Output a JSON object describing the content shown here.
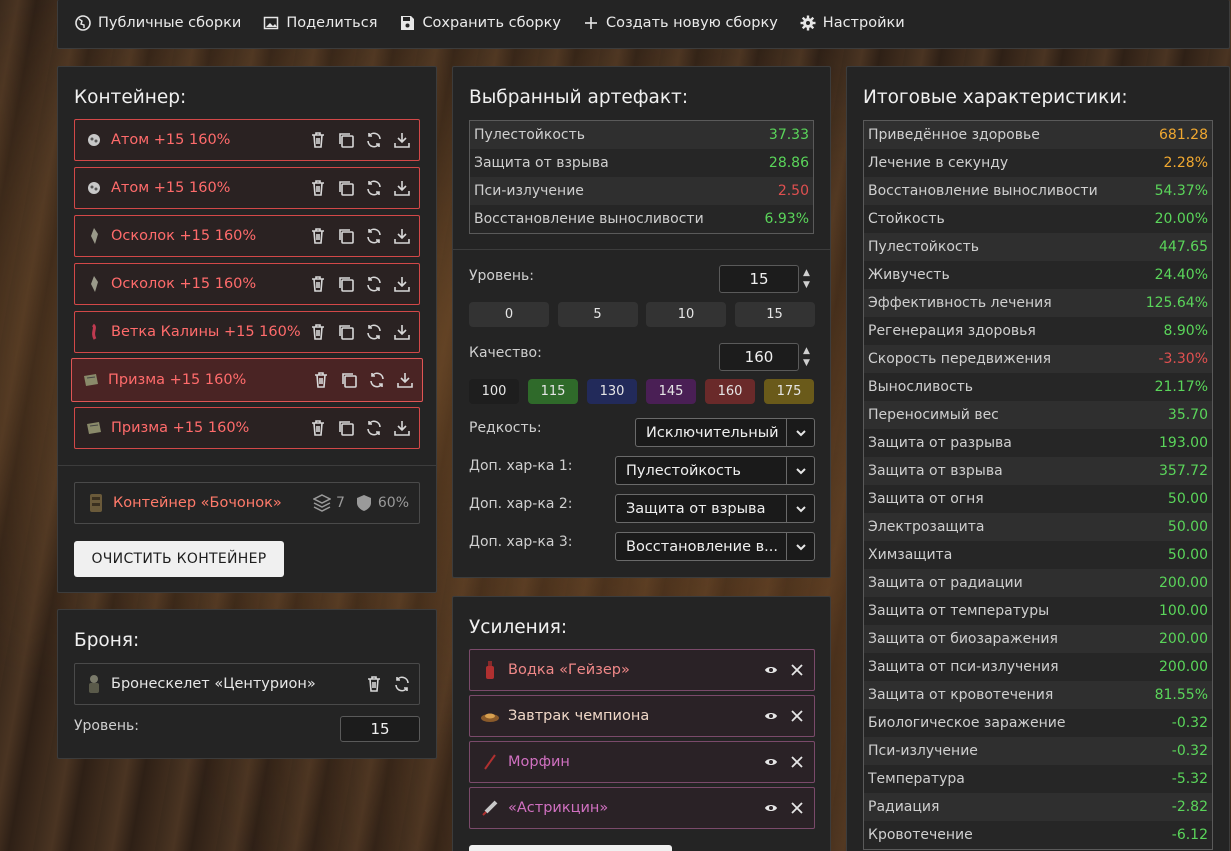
{
  "topbar": {
    "items": [
      {
        "label": "Публичные сборки",
        "icon": "globe-icon"
      },
      {
        "label": "Поделиться",
        "icon": "image-icon"
      },
      {
        "label": "Сохранить сборку",
        "icon": "save-icon"
      },
      {
        "label": "Создать новую сборку",
        "icon": "plus-icon"
      },
      {
        "label": "Настройки",
        "icon": "gear-icon"
      }
    ]
  },
  "container": {
    "title": "Контейнер:",
    "artifacts": [
      {
        "label": "Атом +15 160%",
        "icon": "atom-artifact-icon"
      },
      {
        "label": "Атом +15 160%",
        "icon": "atom-artifact-icon"
      },
      {
        "label": "Осколок +15 160%",
        "icon": "shard-artifact-icon"
      },
      {
        "label": "Осколок +15 160%",
        "icon": "shard-artifact-icon"
      },
      {
        "label": "Ветка Калины +15 160%",
        "icon": "viburnum-artifact-icon"
      },
      {
        "label": "Призма +15 160%",
        "icon": "prism-artifact-icon"
      },
      {
        "label": "Призма +15 160%",
        "icon": "prism-artifact-icon"
      }
    ],
    "selected_index": 5,
    "container_name": "Контейнер «Бочонок»",
    "slots": "7",
    "protection": "60%",
    "clear_button": "ОЧИСТИТЬ КОНТЕЙНЕР"
  },
  "armor": {
    "title": "Броня:",
    "name": "Бронескелет «Центурион»",
    "level_label": "Уровень:",
    "level_value": "15"
  },
  "selected": {
    "title": "Выбранный артефакт:",
    "stats": [
      {
        "label": "Пулестойкость",
        "value": "37.33",
        "color": "green"
      },
      {
        "label": "Защита от взрыва",
        "value": "28.86",
        "color": "green"
      },
      {
        "label": "Пси-излучение",
        "value": "2.50",
        "color": "red"
      },
      {
        "label": "Восстановление выносливости",
        "value": "6.93%",
        "color": "green"
      }
    ],
    "level_label": "Уровень:",
    "level_value": "15",
    "level_presets": [
      "0",
      "5",
      "10",
      "15"
    ],
    "quality_label": "Качество:",
    "quality_value": "160",
    "quality_presets": [
      {
        "label": "100",
        "color": "#1e1e1e"
      },
      {
        "label": "115",
        "color": "#2f6a2a"
      },
      {
        "label": "130",
        "color": "#222a5a"
      },
      {
        "label": "145",
        "color": "#4a1f55"
      },
      {
        "label": "160",
        "color": "#6a2a2a"
      },
      {
        "label": "175",
        "color": "#6a5a1a"
      }
    ],
    "rarity_label": "Редкость:",
    "rarity_value": "Исключительный",
    "extra1_label": "Доп. хар-ка 1:",
    "extra1_value": "Пулестойкость",
    "extra2_label": "Доп. хар-ка 2:",
    "extra2_value": "Защита от взрыва",
    "extra3_label": "Доп. хар-ка 3:",
    "extra3_value": "Восстановление в..."
  },
  "boosts": {
    "title": "Усиления:",
    "items": [
      {
        "label": "Водка «Гейзер»",
        "color": "#f08888",
        "icon": "bottle-icon"
      },
      {
        "label": "Завтрак чемпиона",
        "color": "#f0d8c8",
        "icon": "plate-icon"
      },
      {
        "label": "Морфин",
        "color": "#d070c0",
        "icon": "syringe-icon"
      },
      {
        "label": "«Астрикцин»",
        "color": "#d070c0",
        "icon": "injector-icon"
      }
    ]
  },
  "totals": {
    "title": "Итоговые характеристики:",
    "rows": [
      {
        "label": "Приведённое здоровье",
        "value": "681.28",
        "color": "orange"
      },
      {
        "label": "Лечение в секунду",
        "value": "2.28%",
        "color": "orange"
      },
      {
        "label": "Восстановление выносливости",
        "value": "54.37%",
        "color": "green"
      },
      {
        "label": "Стойкость",
        "value": "20.00%",
        "color": "green"
      },
      {
        "label": "Пулестойкость",
        "value": "447.65",
        "color": "green"
      },
      {
        "label": "Живучесть",
        "value": "24.40%",
        "color": "green"
      },
      {
        "label": "Эффективность лечения",
        "value": "125.64%",
        "color": "green"
      },
      {
        "label": "Регенерация здоровья",
        "value": "8.90%",
        "color": "green"
      },
      {
        "label": "Скорость передвижения",
        "value": "-3.30%",
        "color": "red"
      },
      {
        "label": "Выносливость",
        "value": "21.17%",
        "color": "green"
      },
      {
        "label": "Переносимый вес",
        "value": "35.70",
        "color": "green"
      },
      {
        "label": "Защита от разрыва",
        "value": "193.00",
        "color": "green"
      },
      {
        "label": "Защита от взрыва",
        "value": "357.72",
        "color": "green"
      },
      {
        "label": "Защита от огня",
        "value": "50.00",
        "color": "green"
      },
      {
        "label": "Электрозащита",
        "value": "50.00",
        "color": "green"
      },
      {
        "label": "Химзащита",
        "value": "50.00",
        "color": "green"
      },
      {
        "label": "Защита от радиации",
        "value": "200.00",
        "color": "green"
      },
      {
        "label": "Защита от температуры",
        "value": "100.00",
        "color": "green"
      },
      {
        "label": "Защита от биозаражения",
        "value": "200.00",
        "color": "green"
      },
      {
        "label": "Защита от пси-излучения",
        "value": "200.00",
        "color": "green"
      },
      {
        "label": "Защита от кровотечения",
        "value": "81.55%",
        "color": "green"
      },
      {
        "label": "Биологическое заражение",
        "value": "-0.32",
        "color": "green"
      },
      {
        "label": "Пси-излучение",
        "value": "-0.32",
        "color": "green"
      },
      {
        "label": "Температура",
        "value": "-5.32",
        "color": "green"
      },
      {
        "label": "Радиация",
        "value": "-2.82",
        "color": "green"
      },
      {
        "label": "Кровотечение",
        "value": "-6.12",
        "color": "green"
      }
    ]
  }
}
